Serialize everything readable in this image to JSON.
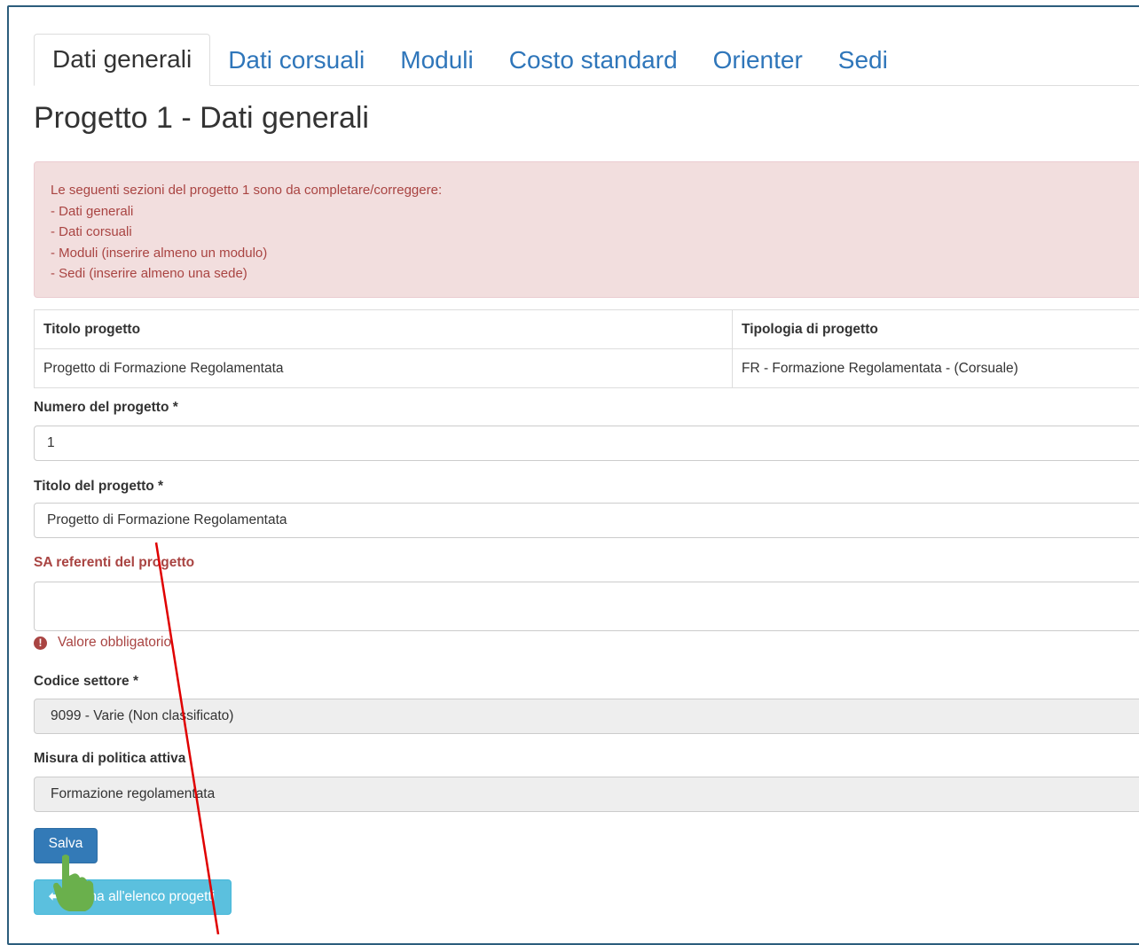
{
  "tabs": [
    {
      "label": "Dati generali",
      "active": true
    },
    {
      "label": "Dati corsuali"
    },
    {
      "label": "Moduli"
    },
    {
      "label": "Costo standard"
    },
    {
      "label": "Orienter"
    },
    {
      "label": "Sedi"
    }
  ],
  "page_title": "Progetto 1 - Dati generali",
  "alert": {
    "lines": [
      "Le seguenti sezioni del progetto 1 sono da completare/correggere:",
      "- Dati generali",
      "- Dati corsuali",
      "- Moduli (inserire almeno un modulo)",
      "- Sedi (inserire almeno una sede)"
    ]
  },
  "info_table": {
    "headers": [
      "Titolo progetto",
      "Tipologia di progetto"
    ],
    "row": [
      "Progetto di Formazione Regolamentata",
      "FR - Formazione Regolamentata - (Corsuale)"
    ]
  },
  "form": {
    "numero_label": "Numero del progetto *",
    "numero_value": "1",
    "titolo_label": "Titolo del progetto *",
    "titolo_value": "Progetto di Formazione Regolamentata",
    "sa_label": "SA referenti del progetto",
    "sa_value": "",
    "sa_error": "Valore obbligatorio",
    "codice_label": "Codice settore *",
    "codice_value": "9099 - Varie (Non classificato)",
    "misura_label": "Misura di politica attiva",
    "misura_value": "Formazione regolamentata"
  },
  "buttons": {
    "save": "Salva",
    "back": "Torna all'elenco progetti"
  },
  "colors": {
    "primary": "#337ab7",
    "info": "#5bc0de",
    "danger_text": "#a94442",
    "danger_bg": "#f2dede",
    "link": "#2f76ba",
    "annotation": "#e00000",
    "hand": "#6ab04c"
  },
  "icons": {
    "error": "exclamation-circle-icon",
    "back": "arrow-left-icon",
    "cursor": "hand-pointer-icon"
  }
}
